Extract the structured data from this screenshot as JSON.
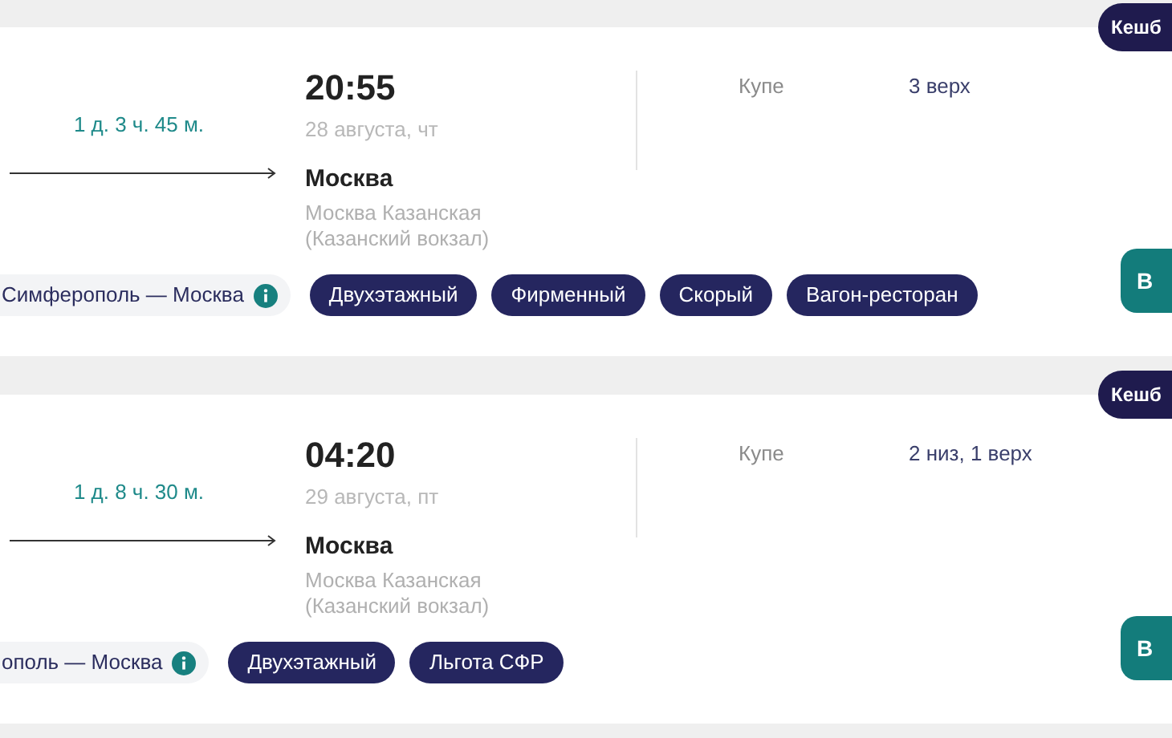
{
  "trips": [
    {
      "cashback_badge": "Кешб",
      "duration": "1 д. 3 ч. 45 м.",
      "arrival_time": "20:55",
      "arrival_date": "28 августа, чт",
      "arrival_city": "Москва",
      "arrival_station": "Москва Казанская (Казанский вокзал)",
      "car_class": "Купе",
      "seats": "3 верх",
      "route": "Симферополь — Москва",
      "tags": [
        "Двухэтажный",
        "Фирменный",
        "Скорый",
        "Вагон-ресторан"
      ],
      "button": "В"
    },
    {
      "cashback_badge": "Кешб",
      "duration": "1 д. 8 ч. 30 м.",
      "arrival_time": "04:20",
      "arrival_date": "29 августа, пт",
      "arrival_city": "Москва",
      "arrival_station": "Москва Казанская (Казанский вокзал)",
      "car_class": "Купе",
      "seats": "2 низ, 1 верх",
      "route": "ополь — Москва",
      "tags": [
        "Двухэтажный",
        "Льгота СФР"
      ],
      "button": "В"
    }
  ]
}
